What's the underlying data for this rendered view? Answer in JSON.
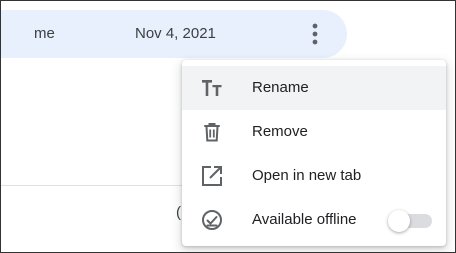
{
  "file_row": {
    "owner": "me",
    "modified": "Nov 4, 2021",
    "more_icon": "more-vert-icon"
  },
  "background": {
    "partial_text": "("
  },
  "menu": {
    "items": [
      {
        "label": "Rename",
        "icon": "text-format-icon",
        "highlighted": true
      },
      {
        "label": "Remove",
        "icon": "trash-icon"
      },
      {
        "label": "Open in new tab",
        "icon": "open-in-new-icon"
      },
      {
        "label": "Available offline",
        "icon": "offline-check-icon",
        "toggle_on": false
      }
    ]
  },
  "colors": {
    "row_selected": "#e8f0fe",
    "menu_hover": "#f1f3f4",
    "icon": "#5f6368",
    "text": "#202124",
    "toggle_track": "#dadce0"
  }
}
